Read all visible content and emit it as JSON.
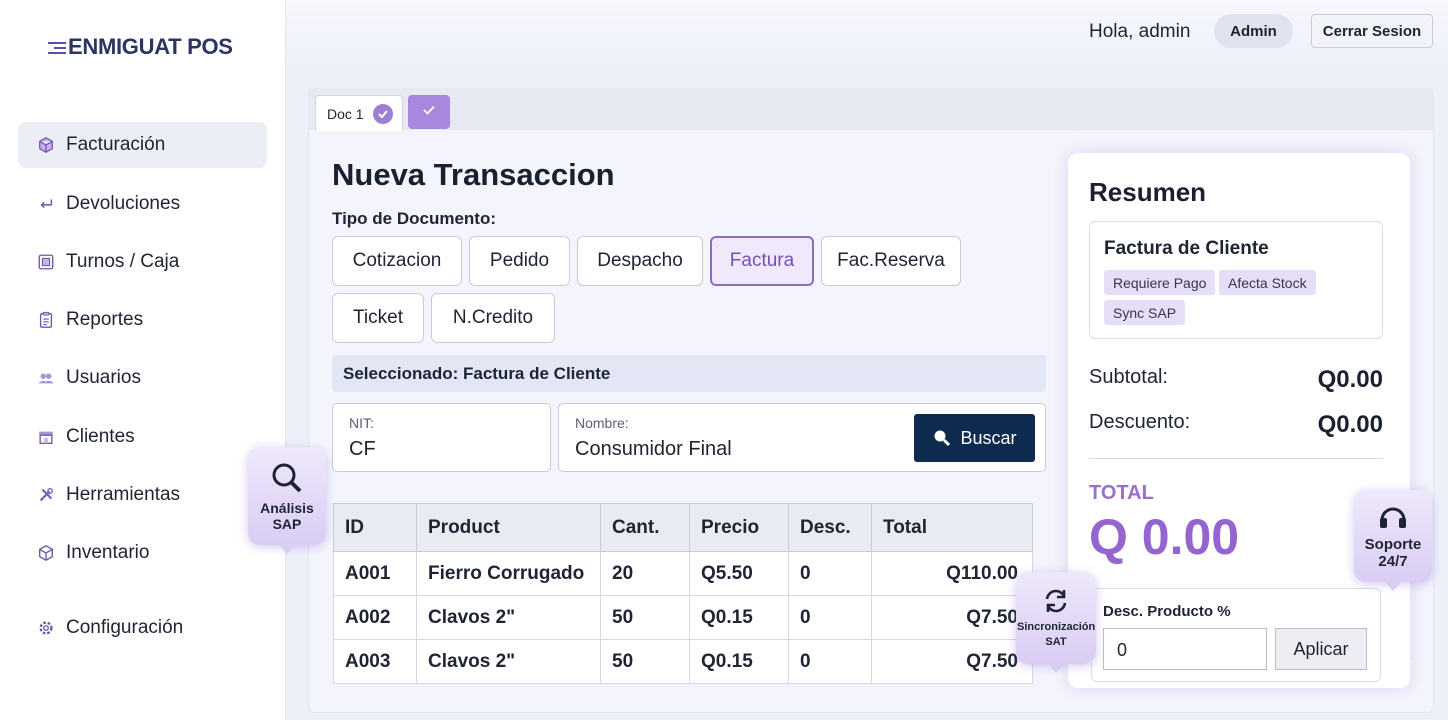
{
  "app": {
    "logo": "ENMIGUAT POS"
  },
  "sidebar": {
    "items": [
      {
        "label": "Facturación",
        "icon": "box-icon",
        "active": true
      },
      {
        "label": "Devoluciones",
        "icon": "return-arrow-icon"
      },
      {
        "label": "Turnos / Caja",
        "icon": "register-icon"
      },
      {
        "label": "Reportes",
        "icon": "clipboard-icon"
      },
      {
        "label": "Usuarios",
        "icon": "users-icon"
      },
      {
        "label": "Clientes",
        "icon": "store-icon"
      },
      {
        "label": "Herramientas",
        "icon": "tools-icon"
      },
      {
        "label": "Inventario",
        "icon": "cube-icon"
      },
      {
        "label": "Configuración",
        "icon": "gear-icon"
      }
    ]
  },
  "header": {
    "greeting": "Hola, admin",
    "role": "Admin",
    "logout": "Cerrar Sesion"
  },
  "tabs": [
    {
      "label": "Doc 1"
    }
  ],
  "main": {
    "title": "Nueva Transaccion",
    "doc_type_label": "Tipo de Documento:",
    "doc_types": [
      "Cotizacion",
      "Pedido",
      "Despacho",
      "Factura",
      "Fac.Reserva",
      "Ticket",
      "N.Credito"
    ],
    "selected_doc_type": "Factura",
    "selected_text": "Seleccionado: Factura de Cliente",
    "nit": {
      "label": "NIT:",
      "value": "CF"
    },
    "nombre": {
      "label": "Nombre:",
      "value": "Consumidor Final"
    },
    "search_button": "Buscar"
  },
  "table": {
    "headers": [
      "ID",
      "Product",
      "Cant.",
      "Precio",
      "Desc.",
      "Total"
    ],
    "rows": [
      [
        "A001",
        "Fierro Corrugado",
        "20",
        "Q5.50",
        "0",
        "Q110.00"
      ],
      [
        "A002",
        "Clavos 2\"",
        "50",
        "Q0.15",
        "0",
        "Q7.50"
      ],
      [
        "A003",
        "Clavos 2\"",
        "50",
        "Q0.15",
        "0",
        "Q7.50"
      ]
    ]
  },
  "summary": {
    "title": "Resumen",
    "doc_name": "Factura de Cliente",
    "tags": [
      "Requiere Pago",
      "Afecta Stock",
      "Sync SAP"
    ],
    "subtotal_label": "Subtotal:",
    "subtotal_value": "Q0.00",
    "discount_label": "Descuento:",
    "discount_value": "Q0.00",
    "total_label": "TOTAL",
    "total_value": "Q 0.00",
    "product_discount_label": "Desc. Producto %",
    "product_discount_value": "0",
    "apply_button": "Aplicar"
  },
  "floating": {
    "analysis": "Análisis SAP",
    "sync": "Sincronización SAT",
    "support": "Soporte 24/7"
  },
  "colors": {
    "accent": "#9464cf",
    "primary_button": "#0e2a4f",
    "selected_border": "#8a6cc8"
  }
}
